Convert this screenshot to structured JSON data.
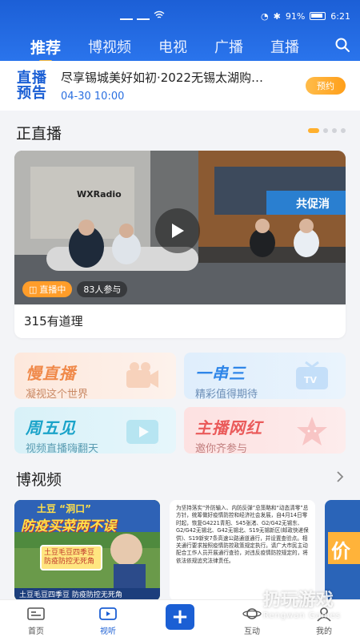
{
  "status_bar": {
    "battery": "91%",
    "time": "6:21"
  },
  "nav": {
    "tabs": [
      "推荐",
      "博视频",
      "电视",
      "广播",
      "直播"
    ],
    "active_index": 0
  },
  "live_preview": {
    "badge_line1": "直播",
    "badge_line2": "预告",
    "title": "尽享锡城美好如初·2022无锡太湖购…",
    "time": "04-30 10:00",
    "button": "预约"
  },
  "live_section": {
    "title": "正直播",
    "carousel_count": 4,
    "carousel_active": 0,
    "card": {
      "status": "直播中",
      "participants": "83人参与",
      "title": "315有道理",
      "studio_sign": "WXRadio",
      "banner_text": "共促消"
    }
  },
  "features": [
    {
      "title": "慢直播",
      "subtitle": "凝视这个世界",
      "color": "#f08a4b"
    },
    {
      "title": "一串三",
      "subtitle": "精彩值得期待",
      "color": "#2f86e8"
    },
    {
      "title": "周五见",
      "subtitle": "视频直播嗨翻天",
      "color": "#1aa3c9"
    },
    {
      "title": "主播网红",
      "subtitle": "邀你齐参与",
      "color": "#ea5a5a"
    }
  ],
  "video_section": {
    "title": "博视频",
    "cards": [
      {
        "headline_top": "土豆 “洞口”",
        "headline_main": "防疫买菜两不误",
        "stamp": "土豆毛豆四季豆 防疫防控无死角",
        "caption": "土豆毛豆四季豆 防疫防控无死角"
      },
      {
        "text": "为坚持落实“外防输入、内防反弹”总策略和“动态清零”总方针，统筹做好疫情防控和经济社会发展，自4月14日零时起，恢复G4221青阳、S45张渚、G2/G42无锡东、G2/G42无锡北、G42无锡北、S19无锡新区(邮政快递保供)、S19新安7条高速公路通道通行，并设置查验点。相关通行要求按照疫情防控政策规定执行。请广大市民主动配合工作人员开展通行查验，对违反疫情防控规定的，将依法依规追究法律责任。"
      },
      {
        "text": "价"
      }
    ]
  },
  "tabbar": {
    "items": [
      "首页",
      "视听",
      "",
      "互动",
      "我的"
    ],
    "active_index": 1,
    "plus": "+"
  },
  "watermark": {
    "main": "扔玩游戏",
    "sub": "Rengwan Games"
  },
  "colors": {
    "primary": "#1b5fd4",
    "accent": "#ffa82a"
  }
}
